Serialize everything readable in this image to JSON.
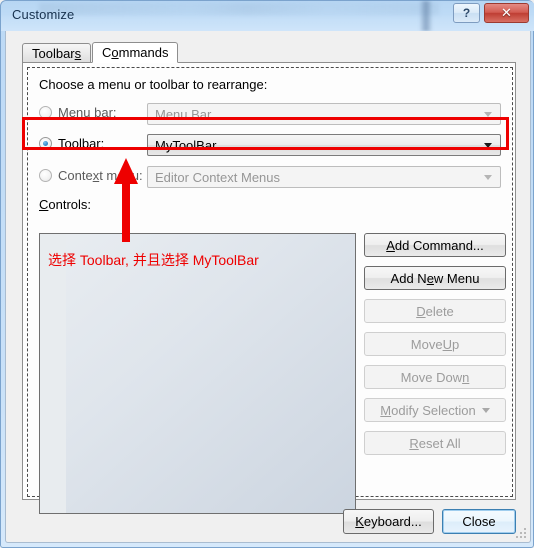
{
  "window": {
    "title": "Customize",
    "help_button": "?",
    "close_button": "✕"
  },
  "tabs": [
    {
      "label_pre": "Toolbar",
      "label_underline": "s",
      "label_post": "",
      "active": false,
      "name": "tab-toolbars"
    },
    {
      "label_pre": "C",
      "label_underline": "o",
      "label_post": "mmands",
      "active": true,
      "name": "tab-commands"
    }
  ],
  "commands_tab": {
    "instruction": "Choose a menu or toolbar to rearrange:",
    "options": [
      {
        "radio_pre": "Menu ",
        "radio_underline": "b",
        "radio_post": "ar:",
        "selected": false,
        "enabled": false,
        "combo_value": "Menu Bar"
      },
      {
        "radio_pre": "",
        "radio_underline": "T",
        "radio_post": "oolbar:",
        "selected": true,
        "enabled": true,
        "combo_value": "MyToolBar"
      },
      {
        "radio_pre": "Conte",
        "radio_underline": "x",
        "radio_post": "t menu:",
        "selected": false,
        "enabled": false,
        "combo_value": "Editor Context Menus"
      }
    ],
    "controls_label_pre": "",
    "controls_label_underline": "C",
    "controls_label_post": "ontrols:",
    "controls_list_items": [],
    "buttons": [
      {
        "pre": "",
        "underline": "A",
        "post": "dd Command...",
        "enabled": true,
        "dropdown": false,
        "name": "add-command-button"
      },
      {
        "pre": "Add N",
        "underline": "e",
        "post": "w Menu",
        "enabled": true,
        "dropdown": false,
        "name": "add-new-menu-button"
      },
      {
        "pre": "",
        "underline": "D",
        "post": "elete",
        "enabled": false,
        "dropdown": false,
        "name": "delete-button"
      },
      {
        "pre": "Move ",
        "underline": "U",
        "post": "p",
        "enabled": false,
        "dropdown": false,
        "name": "move-up-button"
      },
      {
        "pre": "Move Dow",
        "underline": "n",
        "post": "",
        "enabled": false,
        "dropdown": false,
        "name": "move-down-button"
      },
      {
        "pre": "",
        "underline": "M",
        "post": "odify Selection",
        "enabled": false,
        "dropdown": true,
        "name": "modify-selection-button"
      },
      {
        "pre": "",
        "underline": "R",
        "post": "eset All",
        "enabled": false,
        "dropdown": false,
        "name": "reset-all-button"
      }
    ]
  },
  "footer": {
    "keyboard_pre": "",
    "keyboard_underline": "K",
    "keyboard_post": "eyboard...",
    "close_label": "Close"
  },
  "annotation": {
    "text": "选择 Toolbar, 并且选择 MyToolBar",
    "color": "#ee0000",
    "highlight_target": "toolbar-option-row",
    "arrow_points_to": "context-menu-row"
  }
}
